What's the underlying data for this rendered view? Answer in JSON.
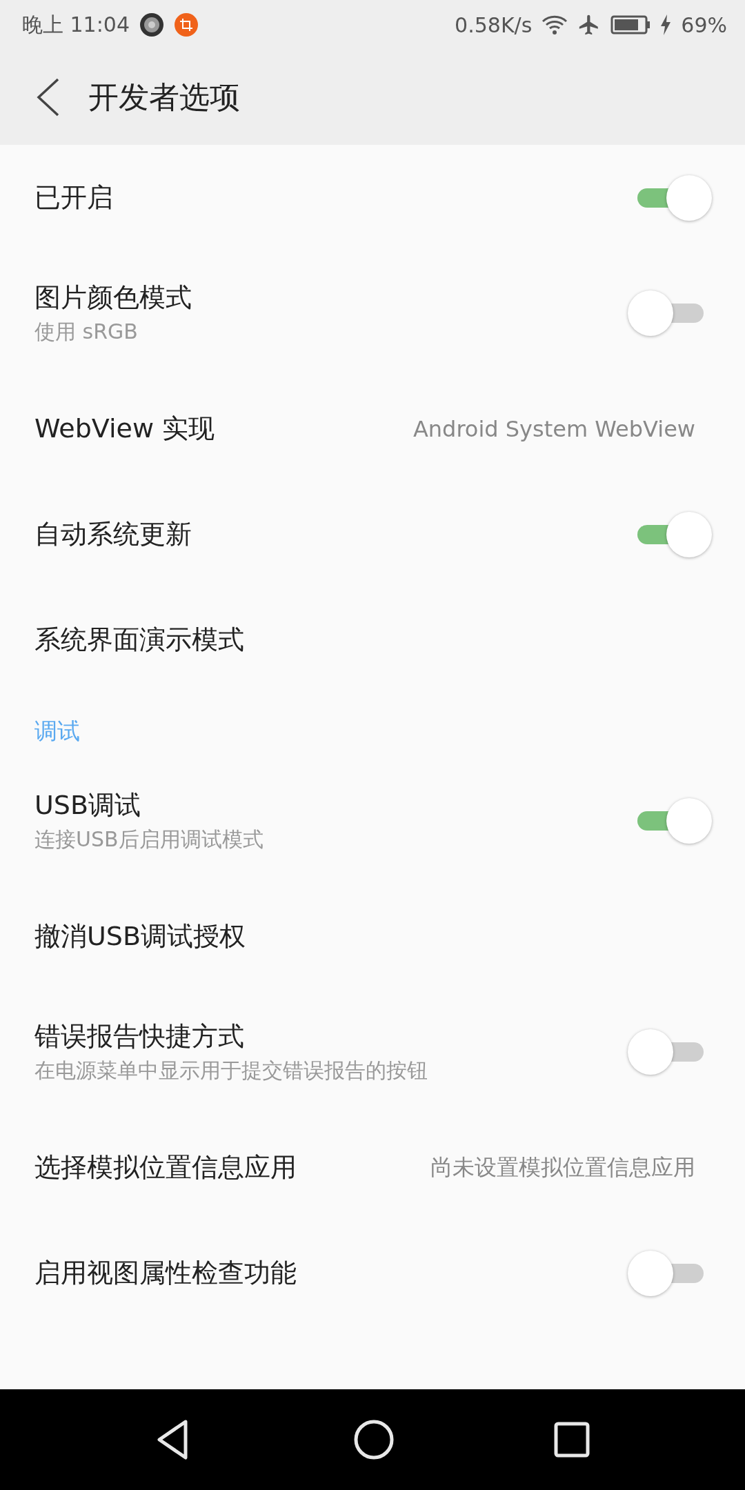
{
  "status_bar": {
    "time": "晚上 11:04",
    "net_speed": "0.58K/s",
    "battery": "69%"
  },
  "header": {
    "title": "开发者选项"
  },
  "items": [
    {
      "kind": "toggle",
      "title": "已开启",
      "on": true
    },
    {
      "kind": "toggle",
      "title": "图片颜色模式",
      "subtitle": "使用 sRGB",
      "on": false
    },
    {
      "kind": "value",
      "title": "WebView 实现",
      "value": "Android System WebView"
    },
    {
      "kind": "toggle",
      "title": "自动系统更新",
      "on": true
    },
    {
      "kind": "plain",
      "title": "系统界面演示模式"
    },
    {
      "kind": "category",
      "title": "调试"
    },
    {
      "kind": "toggle",
      "title": "USB调试",
      "subtitle": "连接USB后启用调试模式",
      "on": true
    },
    {
      "kind": "plain",
      "title": "撤消USB调试授权"
    },
    {
      "kind": "toggle",
      "title": "错误报告快捷方式",
      "subtitle": "在电源菜单中显示用于提交错误报告的按钮",
      "on": false
    },
    {
      "kind": "value",
      "title": "选择模拟位置信息应用",
      "value": "尚未设置模拟位置信息应用"
    },
    {
      "kind": "toggle",
      "title": "启用视图属性检查功能",
      "on": false
    }
  ]
}
